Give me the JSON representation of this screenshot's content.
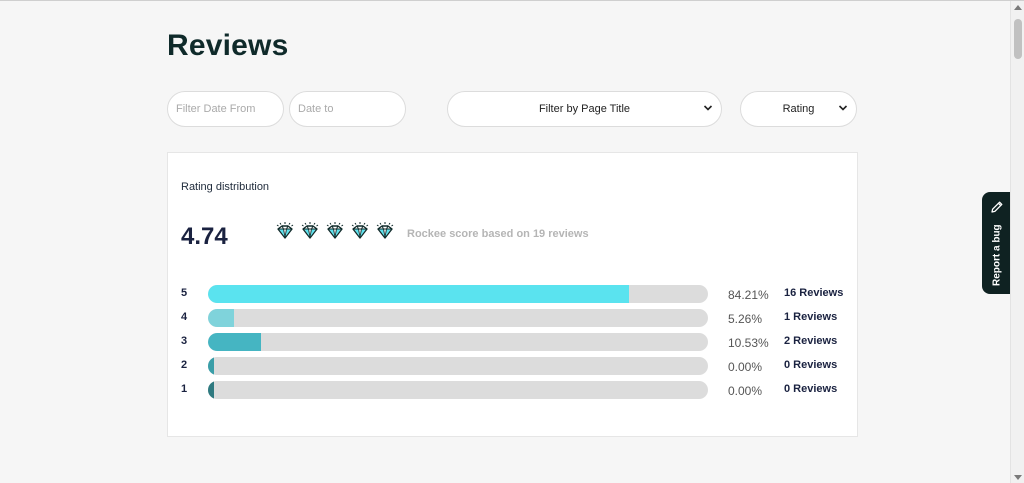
{
  "header": {
    "title": "Reviews"
  },
  "filters": {
    "date_from_placeholder": "Filter Date From",
    "date_to_placeholder": "Date to",
    "page_title_select": "Filter by Page Title",
    "rating_select": "Rating"
  },
  "distribution": {
    "title": "Rating distribution",
    "score": "4.74",
    "gem_icon": "diamond-icon",
    "gem_count": 5,
    "score_note": "Rockee score based on 19 reviews",
    "rows": [
      {
        "rating": "5",
        "percent": "84.21%",
        "reviews": "16 Reviews",
        "fraction": 0.8421,
        "color": "#5ae3ef"
      },
      {
        "rating": "4",
        "percent": "5.26%",
        "reviews": "1 Reviews",
        "fraction": 0.0526,
        "color": "#7fd3db"
      },
      {
        "rating": "3",
        "percent": "10.53%",
        "reviews": "2 Reviews",
        "fraction": 0.1053,
        "color": "#45b5c2"
      },
      {
        "rating": "2",
        "percent": "0.00%",
        "reviews": "0 Reviews",
        "fraction": 0.0,
        "color": "#3a9ea8"
      },
      {
        "rating": "1",
        "percent": "0.00%",
        "reviews": "0 Reviews",
        "fraction": 0.0,
        "color": "#2f7a80"
      }
    ]
  },
  "bug_report": {
    "label": "Report a bug",
    "icon": "pencil-icon"
  },
  "colors": {
    "accent": "#5ae3ef",
    "dark": "#0f2222",
    "track": "#dcdcdc"
  }
}
